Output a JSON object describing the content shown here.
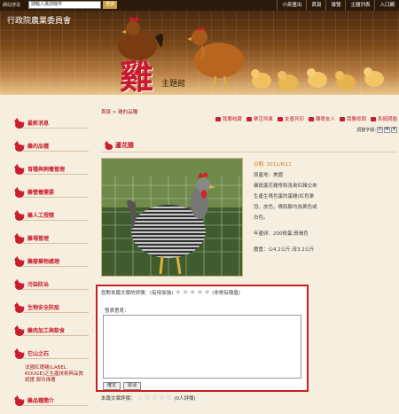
{
  "topbar": {
    "search_label": "網站搜尋",
    "search_placeholder": "請輸入選詞條件",
    "search_button": "查詢",
    "nav": [
      "小英童出",
      "首頁",
      "導覽",
      "主題列表",
      "入口網"
    ]
  },
  "header": {
    "logo_text": "行政院農業委員會",
    "big_char": "雞",
    "theme_label": "主題館"
  },
  "sidebar": {
    "items": [
      {
        "label": "最新消息"
      },
      {
        "label": "雞的品種"
      },
      {
        "label": "育種與飼養管理"
      },
      {
        "label": "雞營養需要"
      },
      {
        "label": "雞人工授精"
      },
      {
        "label": "雞場管理"
      },
      {
        "label": "雞廢棄物處理"
      },
      {
        "label": "污染防治"
      },
      {
        "label": "生物安全防疫"
      },
      {
        "label": "雞肉加工與飲食"
      },
      {
        "label": "它山之石"
      }
    ],
    "submenu": "法國紅牌雞(LABEL ROUGE)之生產技術與品質認證 鄭玲偉著",
    "bottom_item": "雞品種簡介"
  },
  "main": {
    "breadcrumb": "首頁 > 雞的品種",
    "actions": [
      "我要收藏",
      "樂活列車",
      "友善列印",
      "轉寄友人",
      "我要修問",
      "系統問題"
    ],
    "fontsize_label": "調整字級:",
    "fontsize_options": [
      "小",
      "中",
      "大"
    ],
    "title": "蘆花雞",
    "date": "日期: 2011/8/11",
    "info_lines": [
      "原產地：美國",
      "橫斑蘆花雞常和洛島紅雜交來",
      "生產生瑪色蛋的蛋雞(紅色單",
      "冠，皮色，嘴和腳均為黃色或",
      "白色。",
      "",
      "年產卵：200枚蛋,殼褐色",
      "",
      "體重：公4.2公斤,母3.2公斤"
    ]
  },
  "rating": {
    "prompt": "您對本篇文章的評價：(有待加強)",
    "high_label": "(非常有價值)",
    "star_count": 5,
    "comment_label": "發表意見：",
    "ok_button": "確定",
    "cancel_button": "取消",
    "article_rating_label": "本篇文章評價：",
    "article_rating_count": "(0人評價)"
  },
  "colors": {
    "accent_red": "#c81e2e",
    "highlight_border": "#c82020",
    "page_bg": "#f6efe0"
  }
}
